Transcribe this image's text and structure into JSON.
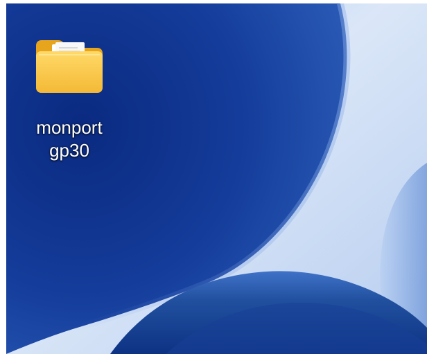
{
  "desktop": {
    "icons": [
      {
        "label_line1": "monport",
        "label_line2": "gp30",
        "icon": "folder-icon"
      }
    ]
  },
  "colors": {
    "wallpaper_deep_blue": "#10348f",
    "wallpaper_mid_blue": "#2b5ab8",
    "wallpaper_light": "#dbe7f8",
    "folder_yellow": "#f6c447",
    "folder_back": "#e8a91f",
    "label_text": "#ffffff"
  }
}
